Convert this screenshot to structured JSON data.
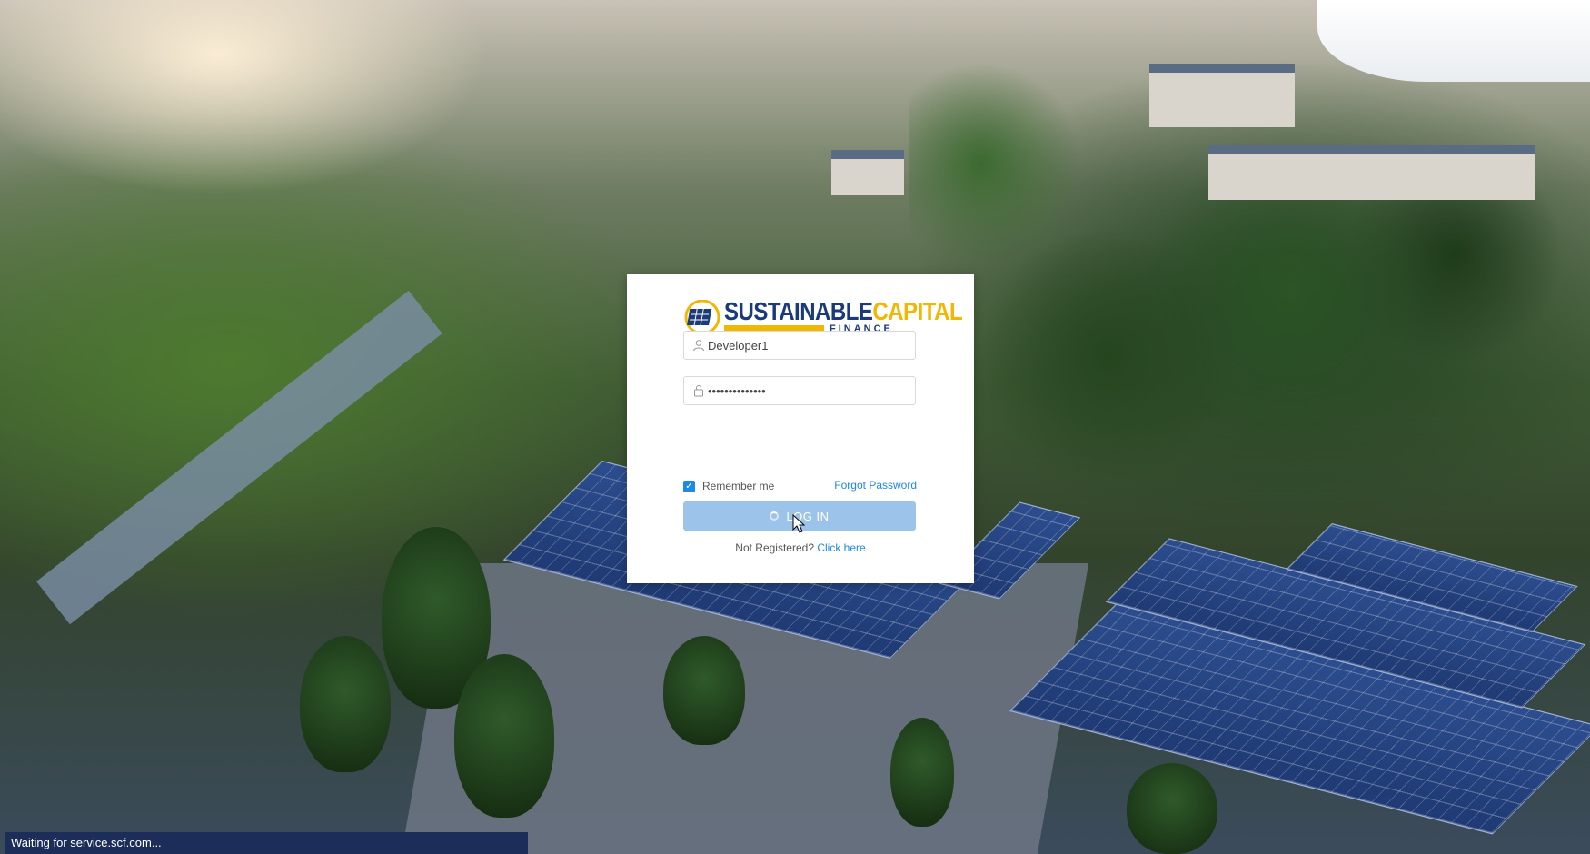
{
  "login_card": {
    "logo": {
      "title_word1": "SUSTAINABLE",
      "title_word2": "CAPITAL",
      "subtitle": "FINANCE",
      "mark_icon": "solar-panel-icon",
      "colors": {
        "navy": "#1b3a7a",
        "gold": "#f2b705"
      }
    },
    "username": {
      "value": "Developer1",
      "icon": "user-icon"
    },
    "password": {
      "value": "••••••••••••••",
      "icon": "lock-icon"
    },
    "remember_me": {
      "label": "Remember me",
      "checked": true
    },
    "forgot_password": "Forgot Password",
    "login_button": {
      "label": "LOG IN",
      "loading": true,
      "color": "#9cc3ea"
    },
    "register": {
      "prompt": "Not Registered?",
      "link": "Click here"
    },
    "link_color": "#1e88e5"
  },
  "status_bar": {
    "text": "Waiting for service.scf.com..."
  }
}
